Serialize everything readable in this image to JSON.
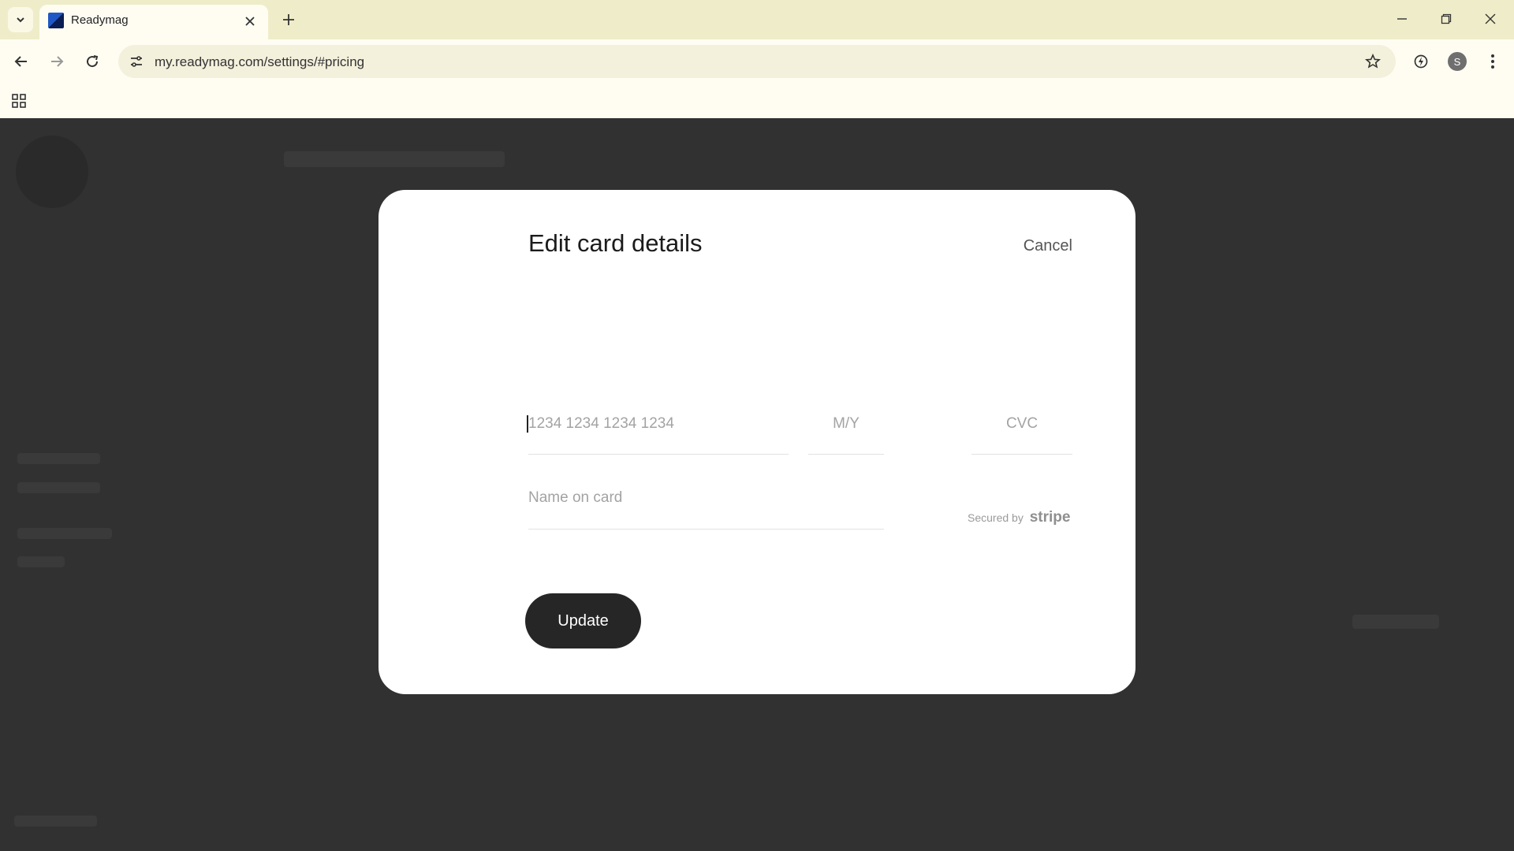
{
  "browser": {
    "tab_title": "Readymag",
    "url": "my.readymag.com/settings/#pricing",
    "profile_initial": "S"
  },
  "modal": {
    "title": "Edit card details",
    "cancel_label": "Cancel",
    "card_number_placeholder": "1234 1234 1234 1234",
    "expiry_placeholder": "M/Y",
    "cvc_placeholder": "CVC",
    "name_placeholder": "Name on card",
    "secured_prefix": "Secured by",
    "secured_brand": "stripe",
    "update_label": "Update"
  },
  "colors": {
    "backdrop": "#313131",
    "modal_bg": "#ffffff",
    "button_bg": "#262626",
    "chrome_bg": "#efedc9"
  }
}
